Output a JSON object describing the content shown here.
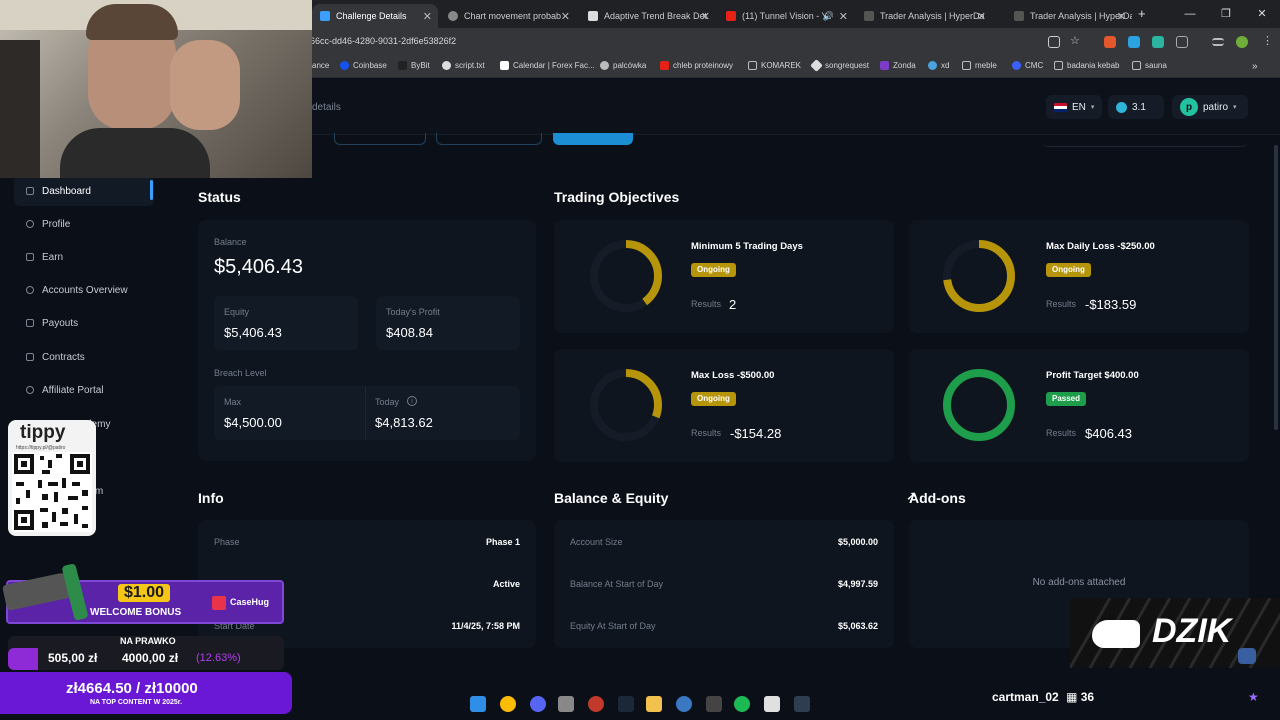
{
  "browser": {
    "tabs": [
      {
        "title": "Challenge Details",
        "active": true
      },
      {
        "title": "Chart movement probab"
      },
      {
        "title": "Adaptive Trend Break Det"
      },
      {
        "title": "(11) Tunnel Vision - Y"
      },
      {
        "title": "Trader Analysis | HyperDa"
      },
      {
        "title": "Trader Analysis | HyperDa"
      }
    ],
    "new_tab": "+",
    "url": "66cc-dd46-4280-9031-2df6e53826f2",
    "bookmarks": [
      "ance",
      "Coinbase",
      "ByBit",
      "script.txt",
      "Calendar | Forex Fac...",
      "palcówka",
      "chleb proteinowy",
      "KOMAREK",
      "songrequest",
      "Zonda",
      "xd",
      "meble",
      "CMC",
      "badania kebab",
      "sauna"
    ],
    "more": "»"
  },
  "header": {
    "breadcrumb": "details",
    "language": "EN",
    "balance_badge": "3.1",
    "user": "patiro",
    "user_initial": "p"
  },
  "sidebar": {
    "items": [
      "Dashboard",
      "Profile",
      "Earn",
      "Accounts Overview",
      "Payouts",
      "Contracts",
      "Affiliate Portal",
      "demy",
      "orm"
    ]
  },
  "status": {
    "title": "Status",
    "balance_label": "Balance",
    "balance": "$5,406.43",
    "equity_label": "Equity",
    "equity": "$5,406.43",
    "profit_label": "Today's Profit",
    "profit": "$408.84",
    "breach_label": "Breach Level",
    "max_label": "Max",
    "max": "$4,500.00",
    "today_label": "Today",
    "today": "$4,813.62"
  },
  "objectives": {
    "title": "Trading Objectives",
    "results_label": "Results",
    "items": [
      {
        "name": "Minimum 5 Trading Days",
        "status": "Ongoing",
        "result": "2",
        "progress": 0.4,
        "color": "#b7950b"
      },
      {
        "name": "Max Daily Loss -$250.00",
        "status": "Ongoing",
        "result": "-$183.59",
        "progress": 0.73,
        "color": "#b7950b"
      },
      {
        "name": "Max Loss -$500.00",
        "status": "Ongoing",
        "result": "-$154.28",
        "progress": 0.31,
        "color": "#b7950b"
      },
      {
        "name": "Profit Target $400.00",
        "status": "Passed",
        "result": "$406.43",
        "progress": 1.0,
        "color": "#1e9e4a"
      }
    ]
  },
  "info": {
    "title": "Info",
    "rows": [
      {
        "k": "Phase",
        "v": "Phase 1"
      },
      {
        "k": "",
        "v": "Active"
      },
      {
        "k": "Start Date",
        "v": "11/4/25, 7:58 PM"
      }
    ]
  },
  "balance_equity": {
    "title": "Balance & Equity",
    "rows": [
      {
        "k": "Account Size",
        "v": "$5,000.00"
      },
      {
        "k": "Balance At Start of Day",
        "v": "$4,997.59"
      },
      {
        "k": "Equity At Start of Day",
        "v": "$5,063.62"
      }
    ]
  },
  "addons": {
    "title": "Add-ons",
    "empty": "No add-ons attached"
  },
  "overlays": {
    "tippy": "tippy",
    "tippy_url": "https://tippy.pl/@patiro",
    "bonus_amount": "$1.00",
    "bonus_text": "WELCOME BONUS",
    "bonus_brand": "CaseHug",
    "bet_title": "NA PRAWKO",
    "bet_line": "505,00 zł",
    "bet_target": "4000,00 zł",
    "bet_pct": "(12.63%)",
    "goal": "zł4664.50 / zł10000",
    "goal_sub": "NA TOP CONTENT W 2025r.",
    "dzik": "DZIK",
    "chat_user": "cartman_02",
    "chat_count": "36"
  }
}
